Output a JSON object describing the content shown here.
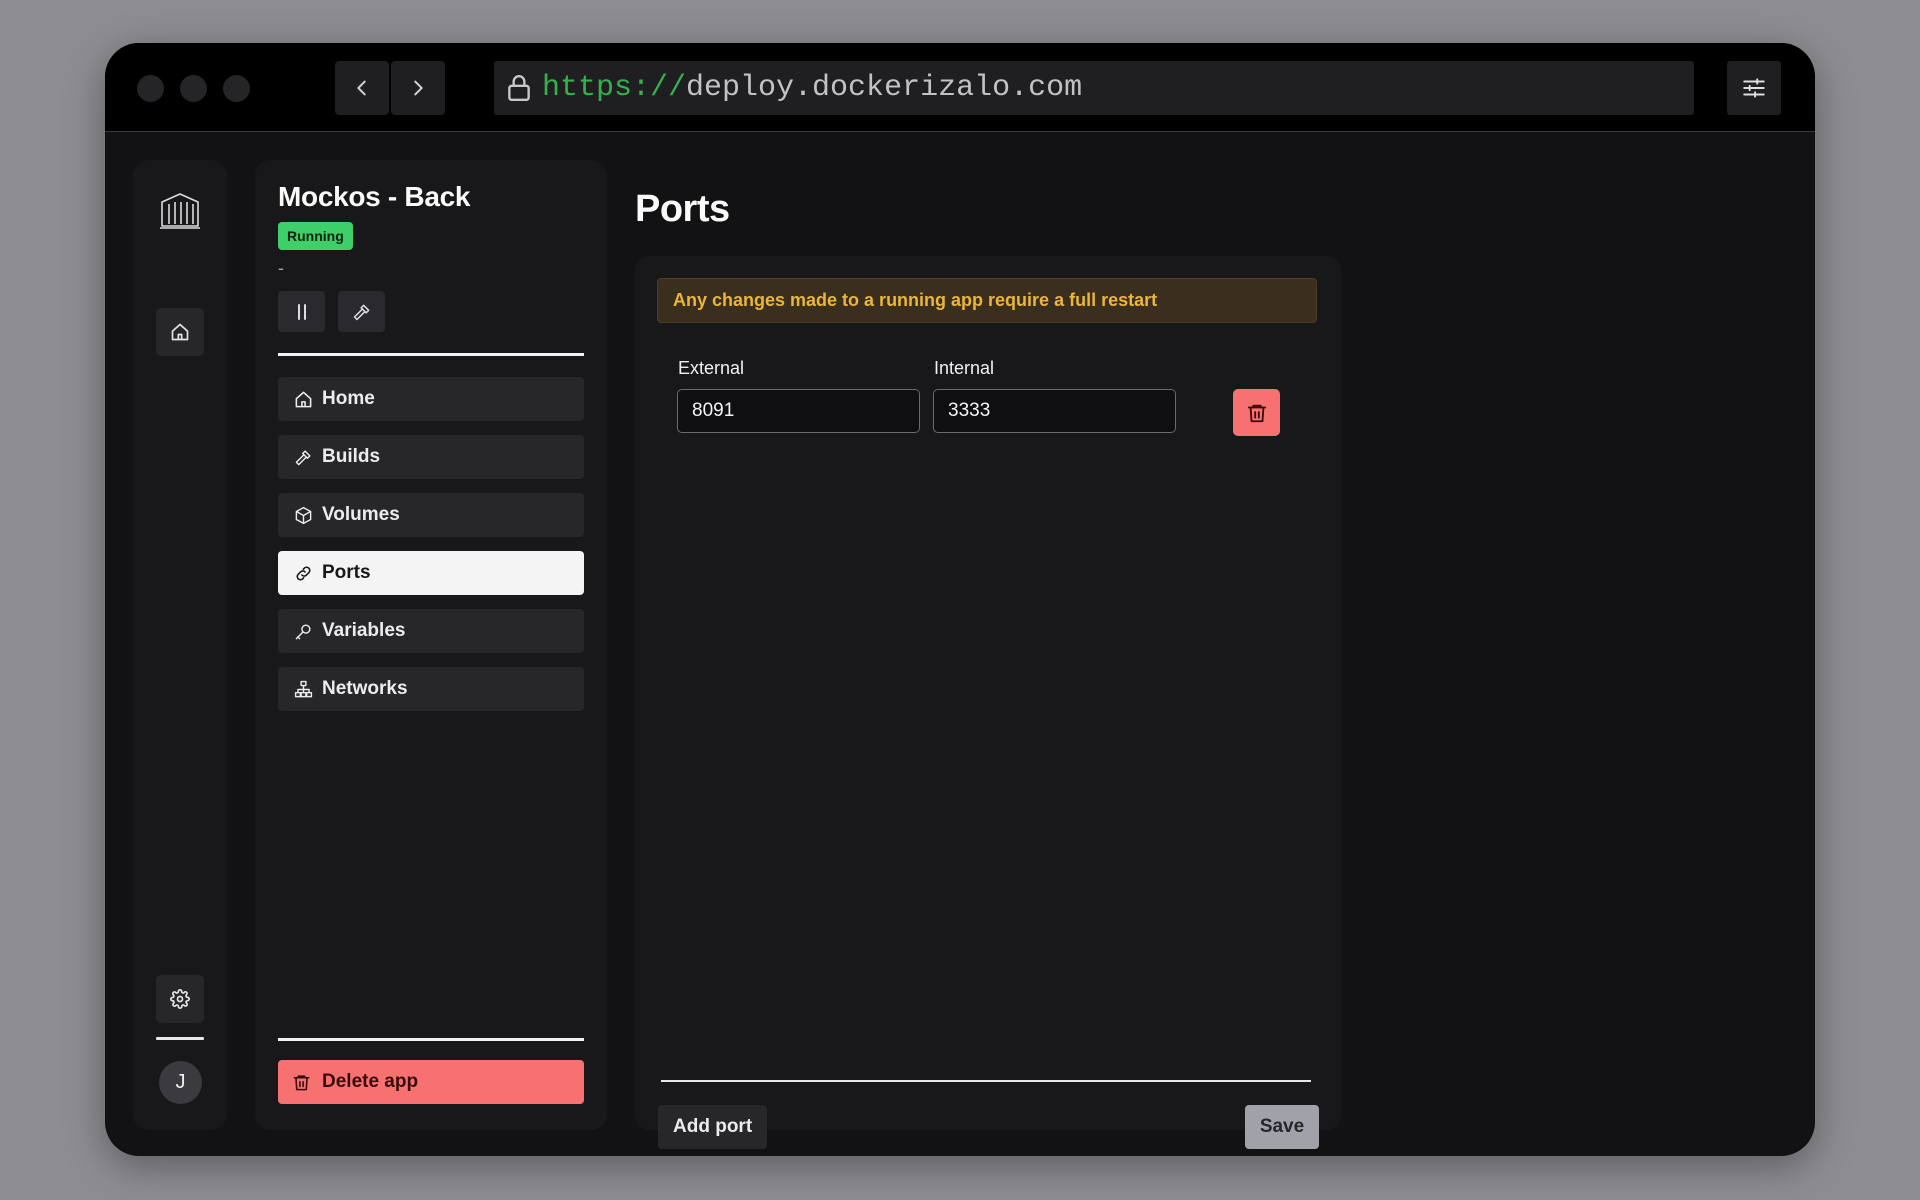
{
  "browser": {
    "url_scheme": "https://",
    "url_host": "deploy.dockerizalo.com"
  },
  "rail": {
    "logo_icon": "building-icon",
    "home_icon": "home-icon",
    "settings_icon": "gear-icon",
    "avatar_initial": "J"
  },
  "app": {
    "title": "Mockos - Back",
    "status": "Running",
    "status_color": "#3ecf6a",
    "description": "-"
  },
  "menu": {
    "items": [
      {
        "label": "Home",
        "icon": "home-icon"
      },
      {
        "label": "Builds",
        "icon": "hammer-icon"
      },
      {
        "label": "Volumes",
        "icon": "box-icon"
      },
      {
        "label": "Ports",
        "icon": "link-icon",
        "active": true
      },
      {
        "label": "Variables",
        "icon": "key-icon"
      },
      {
        "label": "Networks",
        "icon": "network-icon"
      }
    ],
    "delete_label": "Delete app"
  },
  "main": {
    "title": "Ports",
    "warning": "Any changes made to a running app require a full restart",
    "external_label": "External",
    "internal_label": "Internal",
    "ports": [
      {
        "external": "8091",
        "internal": "3333"
      }
    ],
    "add_port_label": "Add port",
    "save_label": "Save"
  },
  "colors": {
    "accent_danger": "#f87171",
    "warning_text": "#eab53a",
    "url_scheme": "#35b04d"
  }
}
